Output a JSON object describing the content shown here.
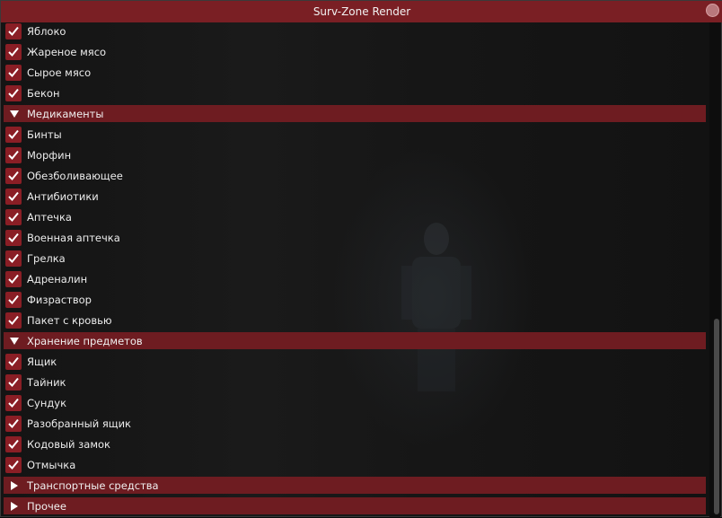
{
  "window": {
    "title": "Surv-Zone Render"
  },
  "food_items": [
    "Яблоко",
    "Жареное мясо",
    "Сырое мясо",
    "Бекон"
  ],
  "sections": {
    "medicine": {
      "label": "Медикаменты",
      "items": [
        "Бинты",
        "Морфин",
        "Обезболивающее",
        "Антибиотики",
        "Аптечка",
        "Военная аптечка",
        "Грелка",
        "Адреналин",
        "Физраствор",
        "Пакет с кровью"
      ]
    },
    "storage": {
      "label": "Хранение предметов",
      "items": [
        "Ящик",
        "Тайник",
        "Сундук",
        "Разобранный ящик",
        "Кодовый замок",
        "Отмычка"
      ]
    },
    "vehicles": {
      "label": "Транспортные средства"
    },
    "other": {
      "label": "Прочее"
    }
  },
  "colors": {
    "accent": "#7a1f24",
    "checkbox": "#8a1e25",
    "header": "#6e1c21"
  }
}
